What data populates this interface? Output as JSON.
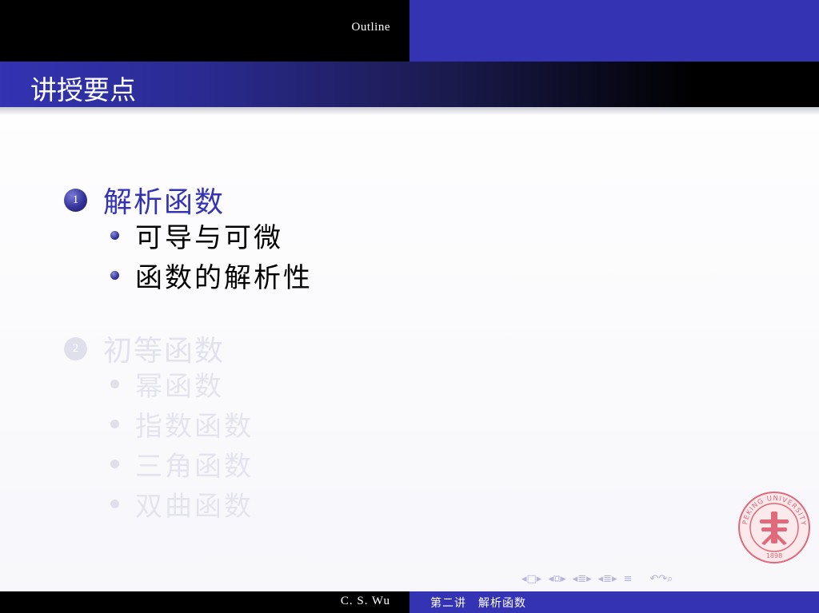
{
  "header": {
    "section_label": "Outline"
  },
  "frame": {
    "title": "讲授要点"
  },
  "outline": {
    "sections": [
      {
        "number": "1",
        "label": "解析函数",
        "subsections": [
          "可导与可微",
          "函数的解析性"
        ]
      },
      {
        "number": "2",
        "label": "初等函数",
        "subsections": [
          "幂函数",
          "指数函数",
          "三角函数",
          "双曲函数"
        ]
      }
    ]
  },
  "seal": {
    "text": "PEKING UNIVERSITY",
    "year": "1898"
  },
  "nav": {
    "icons": [
      "nav-frame-icon",
      "nav-subsection-icon",
      "nav-section-icon",
      "nav-presentation-icon",
      "nav-align-icon",
      "nav-search-icon"
    ]
  },
  "footer": {
    "author": "C. S. Wu",
    "title": "第二讲　解析函数"
  },
  "colors": {
    "beamer_blue": "#3333b3",
    "black": "#000000",
    "seal_red": "#e06a7a",
    "faded": "#e2e2ee"
  }
}
